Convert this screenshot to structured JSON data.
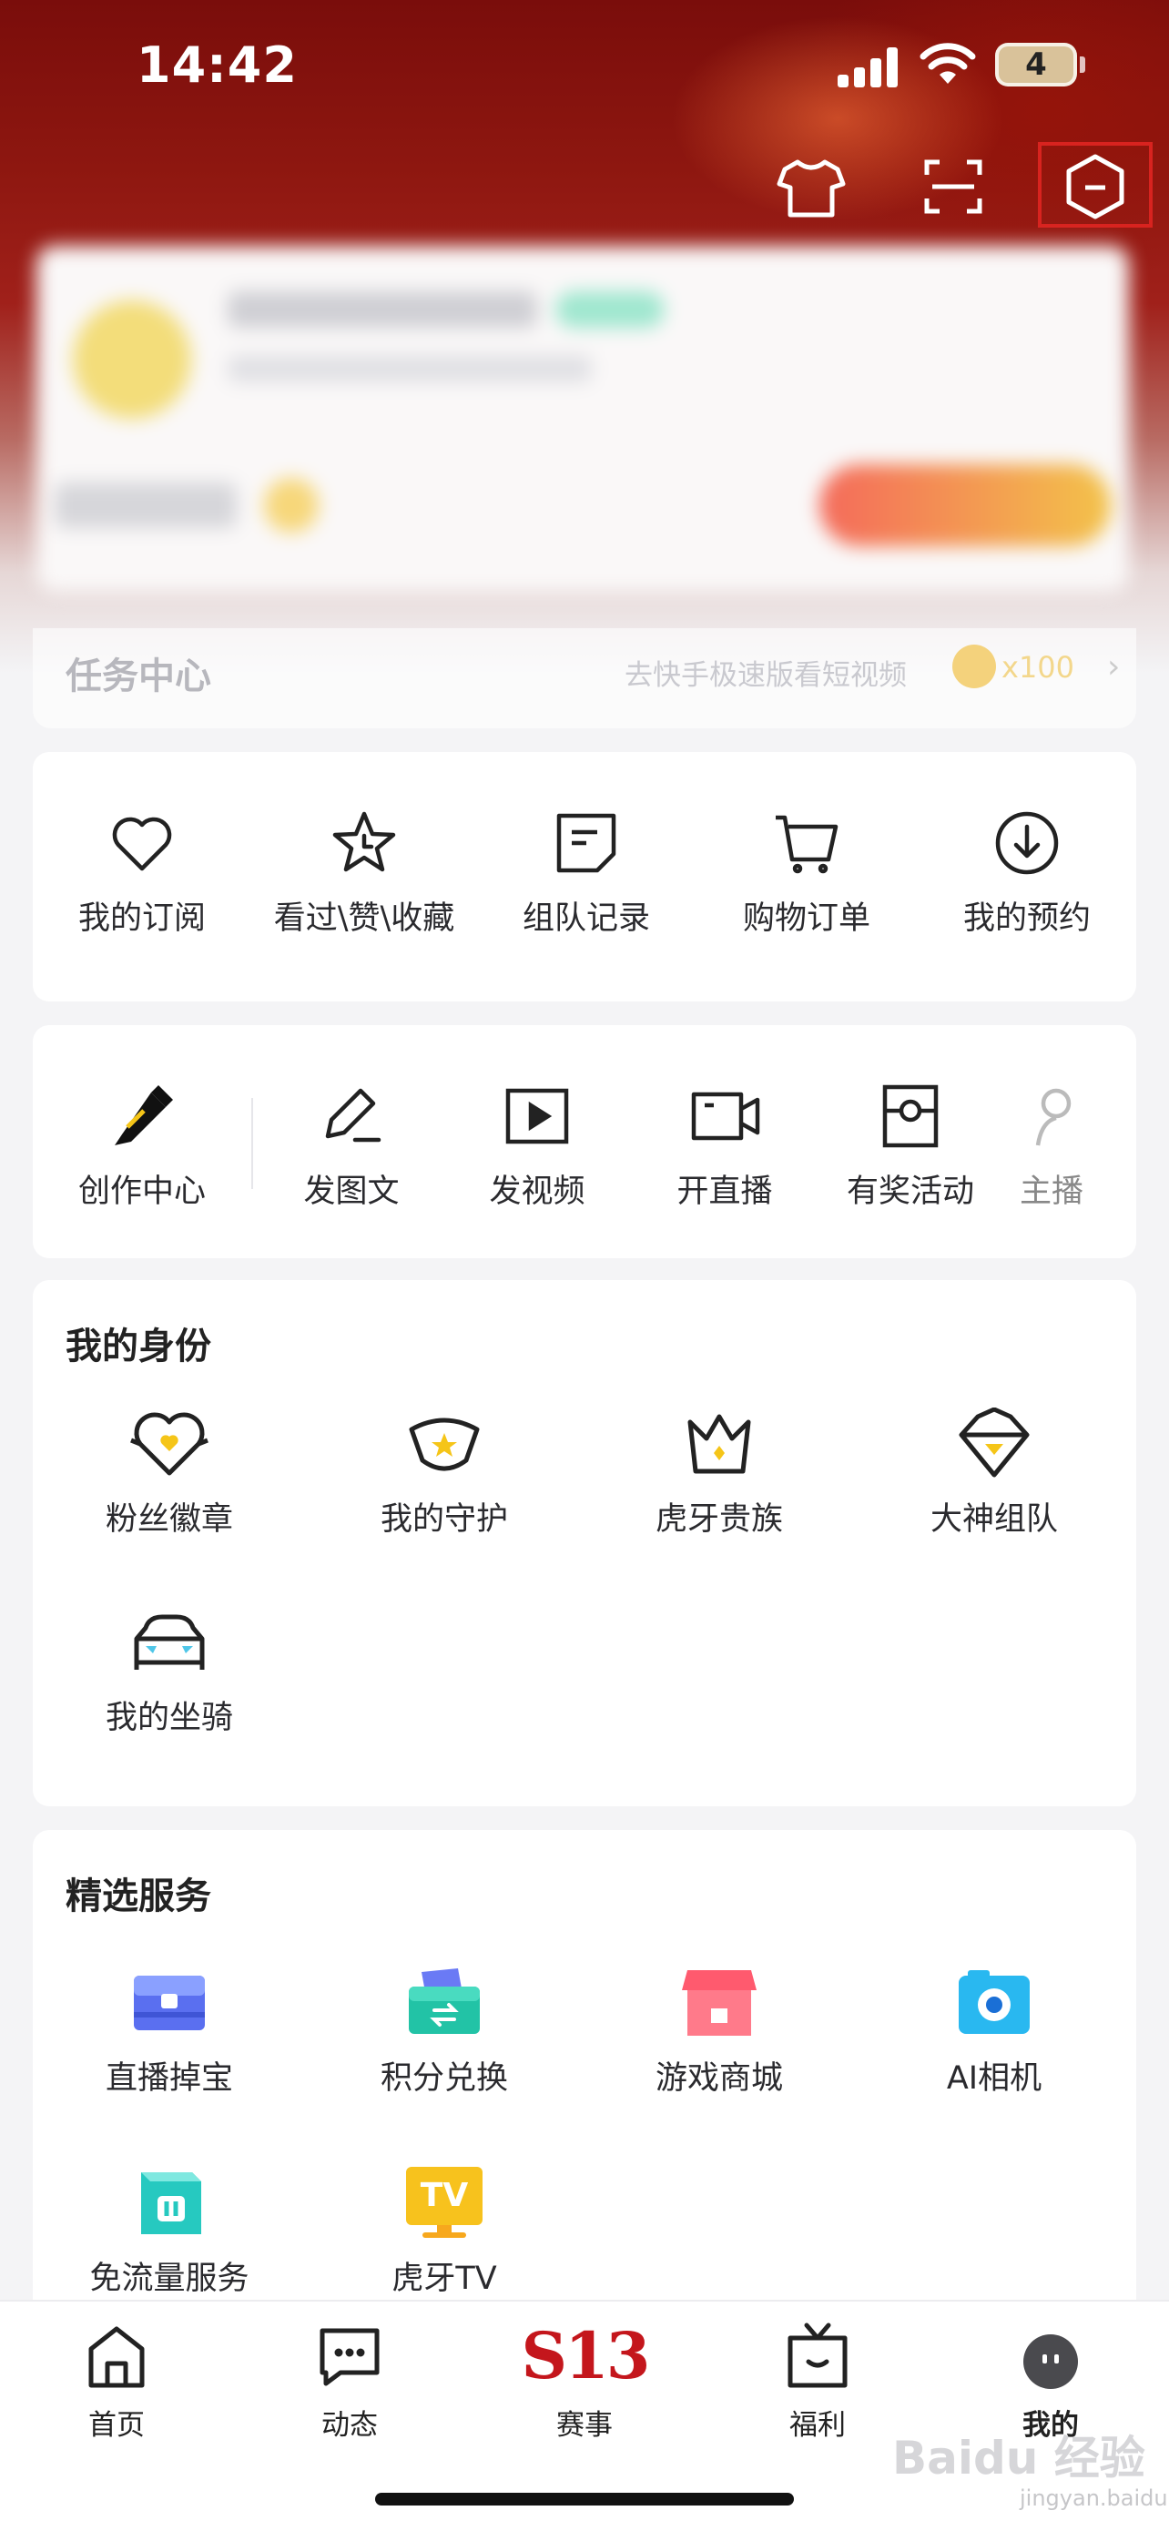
{
  "status_bar": {
    "time": "14:42",
    "battery": "4"
  },
  "header": {
    "icons": [
      "tshirt-icon",
      "scan-icon",
      "hexagon-minus-icon"
    ],
    "highlight_color": "#d8231f"
  },
  "task_center": {
    "title": "任务中心",
    "hint": "去快手极速版看短视频",
    "reward": "x100",
    "arrow": "›"
  },
  "quick_actions": [
    {
      "label": "我的订阅",
      "icon": "heart-icon"
    },
    {
      "label": "看过\\赞\\收藏",
      "icon": "star-clock-icon"
    },
    {
      "label": "组队记录",
      "icon": "note-icon"
    },
    {
      "label": "购物订单",
      "icon": "cart-icon"
    },
    {
      "label": "我的预约",
      "icon": "download-circle-icon"
    }
  ],
  "creator": [
    {
      "label": "创作中心",
      "icon": "pen-nib-icon"
    },
    {
      "label": "发图文",
      "icon": "edit-icon"
    },
    {
      "label": "发视频",
      "icon": "play-box-icon"
    },
    {
      "label": "开直播",
      "icon": "camera-icon"
    },
    {
      "label": "有奖活动",
      "icon": "prize-box-icon"
    },
    {
      "label": "主播",
      "icon": "anchor-icon"
    }
  ],
  "identity": {
    "title": "我的身份",
    "items": [
      {
        "label": "粉丝徽章",
        "icon": "fan-badge-icon"
      },
      {
        "label": "我的守护",
        "icon": "guard-shield-icon"
      },
      {
        "label": "虎牙贵族",
        "icon": "crown-icon"
      },
      {
        "label": "大神组队",
        "icon": "team-crown-icon"
      },
      {
        "label": "我的坐骑",
        "icon": "car-icon"
      }
    ]
  },
  "services": {
    "title": "精选服务",
    "items": [
      {
        "label": "直播掉宝",
        "icon": "treasure-chest-icon"
      },
      {
        "label": "积分兑换",
        "icon": "exchange-box-icon"
      },
      {
        "label": "游戏商城",
        "icon": "store-icon"
      },
      {
        "label": "AI相机",
        "icon": "ai-camera-icon"
      },
      {
        "label": "免流量服务",
        "icon": "data-free-icon"
      },
      {
        "label": "虎牙TV",
        "icon": "tv-icon"
      }
    ],
    "tv_text": "TV"
  },
  "bottom_nav": [
    {
      "label": "首页",
      "icon": "home-icon"
    },
    {
      "label": "动态",
      "icon": "chat-icon"
    },
    {
      "label": "赛事",
      "icon": "s13-logo",
      "logo_text": "S13"
    },
    {
      "label": "福利",
      "icon": "gift-tv-icon"
    },
    {
      "label": "我的",
      "icon": "avatar-icon"
    }
  ],
  "watermark": {
    "main": "Baidu 经验",
    "sub": "jingyan.baidu.com"
  },
  "colors": {
    "accent_red": "#c4161c",
    "gold": "#f5c518"
  }
}
